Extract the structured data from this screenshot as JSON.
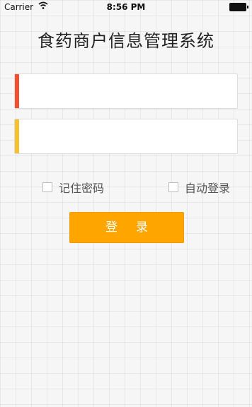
{
  "status_bar": {
    "carrier": "Carrier",
    "wifi_icon": "wifi-icon",
    "time": "8:56 PM",
    "battery_icon": "battery-icon"
  },
  "title": "食药商户信息管理系统",
  "form": {
    "username": {
      "value": "",
      "placeholder": "",
      "accent_color": "#f0522f"
    },
    "password": {
      "value": "",
      "placeholder": "",
      "accent_color": "#f5c131"
    }
  },
  "options": {
    "remember_label": "记住密码",
    "remember_checked": false,
    "auto_label": "自动登录",
    "auto_checked": false
  },
  "login_button": {
    "label": "登录",
    "color": "#ffa500"
  }
}
